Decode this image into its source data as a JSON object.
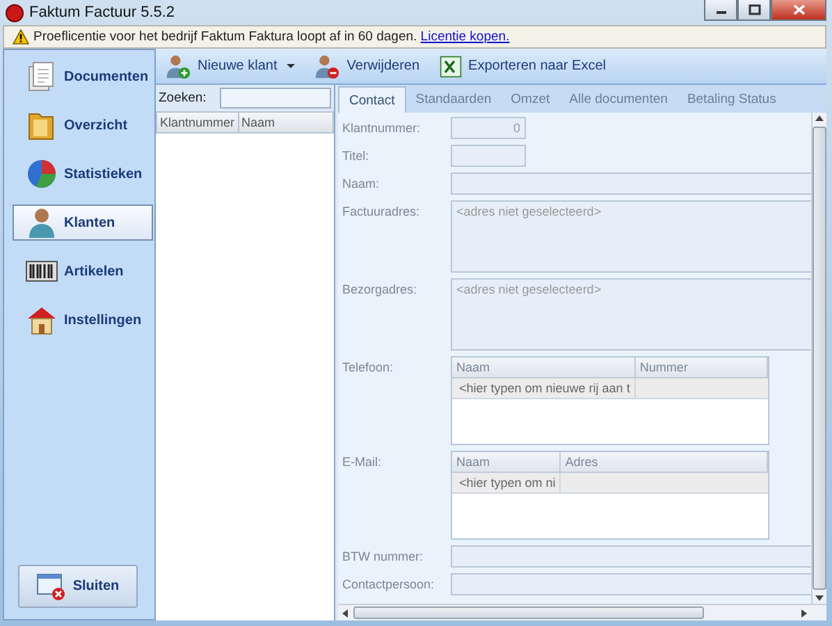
{
  "window": {
    "title": "Faktum Factuur 5.5.2"
  },
  "notice": {
    "text": "Proeflicentie voor het bedrijf Faktum Faktura loopt af in 60 dagen.",
    "link": "Licentie kopen."
  },
  "sidebar": {
    "items": [
      {
        "label": "Documenten",
        "kind": "documents",
        "selected": false
      },
      {
        "label": "Overzicht",
        "kind": "folder",
        "selected": false
      },
      {
        "label": "Statistieken",
        "kind": "chart",
        "selected": false
      },
      {
        "label": "Klanten",
        "kind": "person",
        "selected": true
      },
      {
        "label": "Artikelen",
        "kind": "barcode",
        "selected": false
      },
      {
        "label": "Instellingen",
        "kind": "house",
        "selected": false
      }
    ],
    "close_button": "Sluiten"
  },
  "toolbar": [
    {
      "label": "Nieuwe klant",
      "kind": "add-person",
      "dropdown": true
    },
    {
      "label": "Verwijderen",
      "kind": "remove-person",
      "dropdown": false
    },
    {
      "label": "Exporteren naar Excel",
      "kind": "spreadsheet",
      "dropdown": false
    }
  ],
  "search": {
    "label": "Zoeken:"
  },
  "customer_list": {
    "columns": [
      "Klantnummer",
      "Naam"
    ]
  },
  "tabs": [
    {
      "label": "Contact",
      "selected": true
    },
    {
      "label": "Standaarden",
      "selected": false
    },
    {
      "label": "Omzet",
      "selected": false
    },
    {
      "label": "Alle documenten",
      "selected": false
    },
    {
      "label": "Betaling Status",
      "selected": false
    }
  ],
  "form": {
    "fields": [
      {
        "label": "Klantnummer:",
        "kind": "short",
        "value": "0"
      },
      {
        "label": "Titel:",
        "kind": "short"
      },
      {
        "label": "Naam:",
        "kind": "line"
      },
      {
        "label": "Factuuradres:",
        "kind": "area",
        "placeholder": "<adres niet geselecteerd>"
      },
      {
        "label": "Bezorgadres:",
        "kind": "area",
        "placeholder": "<adres niet geselecteerd>"
      },
      {
        "label": "Telefoon:",
        "kind": "grid",
        "columns": [
          "Naam",
          "Nummer"
        ],
        "new_row": "<hier typen om nieuwe rij aan t"
      },
      {
        "label": "E-Mail:",
        "kind": "grid",
        "columns": [
          "Naam",
          "Adres"
        ],
        "new_row": "<hier typen om ni"
      },
      {
        "label": "BTW nummer:",
        "kind": "line"
      },
      {
        "label": "Contactpersoon:",
        "kind": "line"
      }
    ]
  }
}
